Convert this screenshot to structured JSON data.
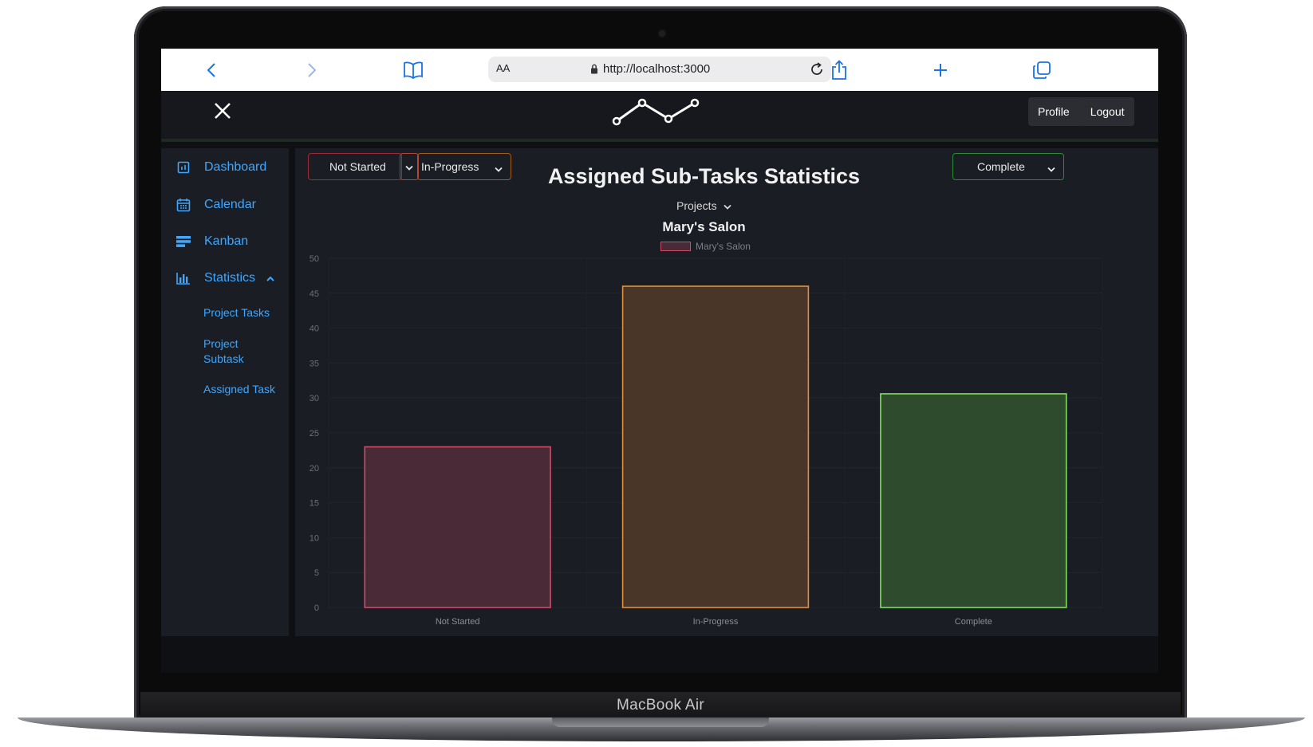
{
  "browser": {
    "text_size_label": "AA",
    "url": "http://localhost:3000",
    "icons": [
      "back-icon",
      "forward-icon",
      "bookmarks-icon",
      "lock-icon",
      "reload-icon",
      "share-icon",
      "new-tab-icon",
      "tabs-icon"
    ]
  },
  "laptop_label": "MacBook Air",
  "header": {
    "profile_label": "Profile",
    "logout_label": "Logout"
  },
  "sidebar": {
    "items": [
      {
        "label": "Dashboard",
        "icon": "dashboard-icon"
      },
      {
        "label": "Calendar",
        "icon": "calendar-icon"
      },
      {
        "label": "Kanban",
        "icon": "kanban-icon"
      },
      {
        "label": "Statistics",
        "icon": "statistics-icon"
      }
    ],
    "statistics_sub": [
      {
        "label": "Project Tasks"
      },
      {
        "label": "Project Subtask"
      },
      {
        "label": "Assigned Task"
      }
    ]
  },
  "filters": {
    "not_started": "Not Started",
    "in_progress": "In-Progress",
    "complete": "Complete",
    "projects": "Projects"
  },
  "colors": {
    "not_started": "#d04b6a",
    "in_progress": "#e0913a",
    "complete": "#7fe05a"
  },
  "chart_data": {
    "type": "bar",
    "title": "Assigned Sub-Tasks Statistics",
    "subtitle": "Mary's Salon",
    "categories": [
      "Not Started",
      "In-Progress",
      "Complete"
    ],
    "series": [
      {
        "name": "Mary's Salon",
        "values": [
          23,
          46,
          30.6
        ]
      }
    ],
    "ylim": [
      0,
      50
    ],
    "yticks": [
      0,
      5,
      10,
      15,
      20,
      25,
      30,
      35,
      40,
      45,
      50
    ],
    "grid": true,
    "legend": "top-center"
  }
}
